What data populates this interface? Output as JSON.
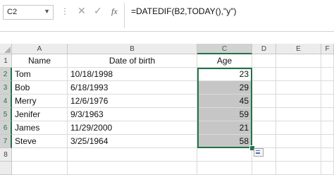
{
  "name_box": "C2",
  "formula": "=DATEDIF(B2,TODAY(),\"y\")",
  "formula_buttons": {
    "cancel": "✕",
    "enter": "✓",
    "fx": "fx"
  },
  "columns": [
    "A",
    "B",
    "C",
    "D",
    "E",
    "F"
  ],
  "rows": [
    "1",
    "2",
    "3",
    "4",
    "5",
    "6",
    "7",
    "8"
  ],
  "header": {
    "name": "Name",
    "dob": "Date of birth",
    "age": "Age"
  },
  "people": [
    {
      "name": "Tom",
      "dob": "10/18/1998",
      "age": "23"
    },
    {
      "name": "Bob",
      "dob": "6/18/1993",
      "age": "29"
    },
    {
      "name": "Merry",
      "dob": "12/6/1976",
      "age": "45"
    },
    {
      "name": "Jenifer",
      "dob": "9/3/1963",
      "age": "59"
    },
    {
      "name": "James",
      "dob": "11/29/2000",
      "age": "21"
    },
    {
      "name": "Steve",
      "dob": "3/25/1964",
      "age": "58"
    }
  ],
  "accent_color": "#217346"
}
